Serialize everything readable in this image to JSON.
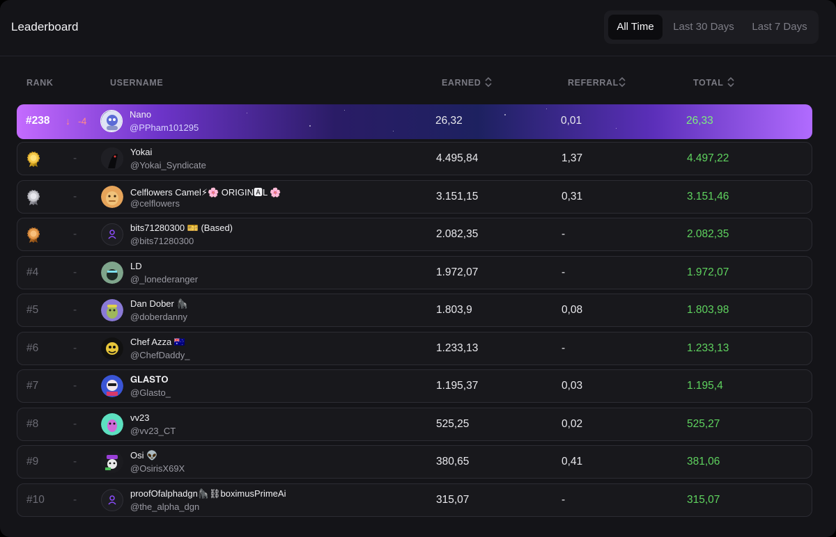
{
  "header": {
    "title": "Leaderboard",
    "tabs": [
      {
        "label": "All Time",
        "active": true
      },
      {
        "label": "Last 30 Days",
        "active": false
      },
      {
        "label": "Last 7 Days",
        "active": false
      }
    ]
  },
  "table": {
    "columns": {
      "rank": "RANK",
      "username": "USERNAME",
      "earned": "EARNED",
      "referral": "REFERRAL",
      "total": "TOTAL"
    },
    "current_user": {
      "rank": "#238",
      "change_arrow": "↓",
      "change": "-4",
      "name": "Nano",
      "handle": "@PPham101295",
      "earned": "26,32",
      "referral": "0,01",
      "total": "26,33"
    },
    "rows": [
      {
        "rank": "",
        "medal": "gold-medal-icon",
        "change": "-",
        "name": "Yokai",
        "handle": "@Yokai_Syndicate",
        "earned": "4.495,84",
        "referral": "1,37",
        "total": "4.497,22"
      },
      {
        "rank": "",
        "medal": "silver-medal-icon",
        "change": "-",
        "name": "Celflowers Camel⚡🌸 ORIGIN🅰L 🌸",
        "handle": "@celflowers",
        "earned": "3.151,15",
        "referral": "0,31",
        "total": "3.151,46"
      },
      {
        "rank": "",
        "medal": "bronze-medal-icon",
        "change": "-",
        "name": "bits71280300 🎫 (Based)",
        "handle": "@bits71280300",
        "earned": "2.082,35",
        "referral": "-",
        "total": "2.082,35"
      },
      {
        "rank": "#4",
        "change": "-",
        "name": "LD",
        "handle": "@_lonederanger",
        "earned": "1.972,07",
        "referral": "-",
        "total": "1.972,07"
      },
      {
        "rank": "#5",
        "change": "-",
        "name": "Dan Dober 🦍",
        "handle": "@doberdanny",
        "earned": "1.803,9",
        "referral": "0,08",
        "total": "1.803,98"
      },
      {
        "rank": "#6",
        "change": "-",
        "name": "Chef Azza 🇦🇺",
        "handle": "@ChefDaddy_",
        "earned": "1.233,13",
        "referral": "-",
        "total": "1.233,13"
      },
      {
        "rank": "#7",
        "change": "-",
        "name": "𝐆𝐋𝐀𝐒𝐓𝐎",
        "handle": "@Glasto_",
        "earned": "1.195,37",
        "referral": "0,03",
        "total": "1.195,4"
      },
      {
        "rank": "#8",
        "change": "-",
        "name": "vv23",
        "handle": "@vv23_CT",
        "earned": "525,25",
        "referral": "0,02",
        "total": "525,27"
      },
      {
        "rank": "#9",
        "change": "-",
        "name": "Osi 👽",
        "handle": "@OsirisX69X",
        "earned": "380,65",
        "referral": "0,41",
        "total": "381,06"
      },
      {
        "rank": "#10",
        "change": "-",
        "name": "proofOfalphadgn🦍⛓boximusPrimeAi",
        "handle": "@the_alpha_dgn",
        "earned": "315,07",
        "referral": "-",
        "total": "315,07"
      }
    ]
  },
  "colors": {
    "accent": "#9b4dff",
    "total_green": "#5fd35f",
    "background": "#141418"
  }
}
